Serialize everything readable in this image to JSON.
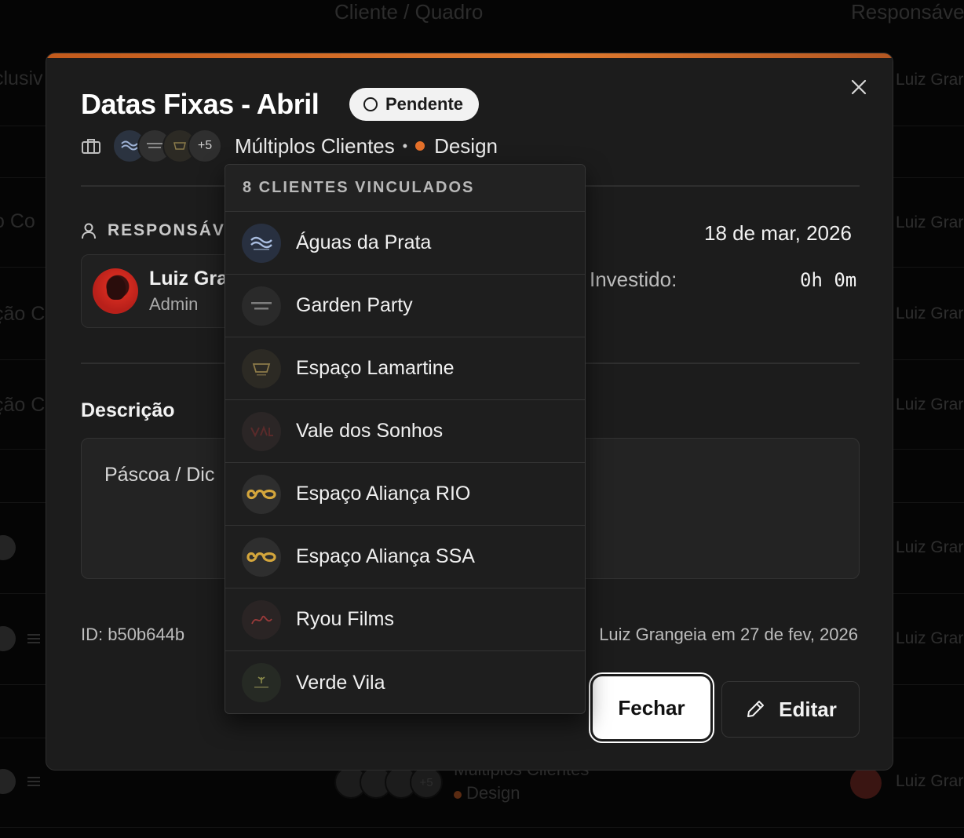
{
  "background": {
    "headers": [
      "Cliente / Quadro",
      "Responsáve"
    ],
    "left_fragments": [
      "clusiv",
      "o Co",
      "ção C",
      "ção C"
    ],
    "right_names": [
      "Luiz Grar",
      "Luiz Grar",
      "Luiz Grar",
      "Luiz Grar",
      "Luiz Grar",
      "Luiz Grar",
      "Luiz Grar"
    ],
    "bottom_row": {
      "client": "Múltiplos Clientes",
      "tag": "Design",
      "more": "+5"
    }
  },
  "modal": {
    "title": "Datas Fixas - Abril",
    "status": "Pendente",
    "clients_more": "+5",
    "clients_label": "Múltiplos Clientes",
    "bullet": "•",
    "category": "Design",
    "category_color": "#e4702a",
    "accent_color": "#d9692a",
    "responsible_label": "RESPONSÁVE",
    "responsible": {
      "name": "Luiz Gra",
      "role": "Admin"
    },
    "date": "18 de mar, 2026",
    "invested_label": "Investido:",
    "invested_value": "0h 0m",
    "description_title": "Descrição",
    "description_text": "Páscoa / Dic",
    "id_text": "ID: b50b644b",
    "created_text": "Luiz Grangeia em 27 de fev, 2026",
    "close_label": "Fechar",
    "edit_label": "Editar"
  },
  "dropdown": {
    "header": "8 CLIENTES VINCULADOS",
    "items": [
      {
        "label": "Águas da Prata",
        "icon": "aguas-da-prata-logo"
      },
      {
        "label": "Garden Party",
        "icon": "garden-party-logo"
      },
      {
        "label": "Espaço Lamartine",
        "icon": "espaco-lamartine-logo"
      },
      {
        "label": "Vale dos Sonhos",
        "icon": "vale-dos-sonhos-logo"
      },
      {
        "label": "Espaço Aliança RIO",
        "icon": "alianca-logo"
      },
      {
        "label": "Espaço Aliança SSA",
        "icon": "alianca-logo"
      },
      {
        "label": "Ryou Films",
        "icon": "ryou-films-logo"
      },
      {
        "label": "Verde Vila",
        "icon": "verde-vila-logo"
      }
    ]
  }
}
